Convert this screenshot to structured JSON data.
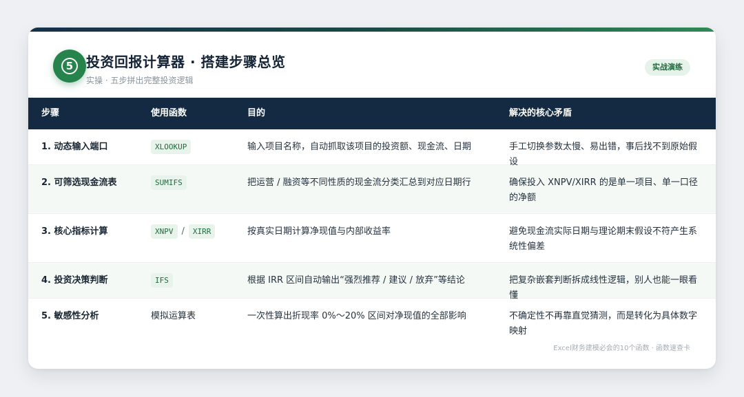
{
  "header": {
    "step_badge": "5",
    "title": "投资回报计算器 · 搭建步骤总览",
    "subtitle": "实操 · 五步拼出完整投资逻辑",
    "pill_label": "实战演练"
  },
  "table": {
    "columns": [
      "步骤",
      "使用函数",
      "目的",
      "解决的核心矛盾"
    ],
    "rows": [
      {
        "step": "1. 动态输入端口",
        "functions": [
          "XLOOKUP"
        ],
        "purpose": "输入项目名称，自动抓取该项目的投资额、现金流、日期",
        "conflict": "手工切换参数太慢、易出错，事后找不到原始假设"
      },
      {
        "step": "2. 可筛选现金流表",
        "functions": [
          "SUMIFS"
        ],
        "purpose": "把运营 / 融资等不同性质的现金流分类汇总到对应日期行",
        "conflict": "确保投入 XNPV/XIRR 的是单一项目、单一口径的净额"
      },
      {
        "step": "3. 核心指标计算",
        "functions": [
          "XNPV",
          "XIRR"
        ],
        "function_separator": "/",
        "purpose": "按真实日期计算净现值与内部收益率",
        "conflict": "避免现金流实际日期与理论期末假设不符产生系统性偏差"
      },
      {
        "step": "4. 投资决策判断",
        "functions": [
          "IFS"
        ],
        "purpose": "根据 IRR 区间自动输出“强烈推荐 / 建议 / 放弃”等结论",
        "conflict": "把复杂嵌套判断拆成线性逻辑，别人也能一眼看懂"
      },
      {
        "step": "5. 敏感性分析",
        "function_text": "模拟运算表",
        "purpose": "一次性算出折现率 0%～20% 区间对净现值的全部影响",
        "conflict": "不确定性不再靠直觉猜测，而是转化为具体数字映射"
      }
    ]
  },
  "footer": {
    "text": "Excel财务建模必会的10个函数 · 函数速查卡"
  },
  "colors": {
    "header_bg": "#142a43",
    "accent_green": "#27834c",
    "alt_row_bg": "#f4f9f5",
    "code_bg": "#e8f3ec",
    "code_text": "#1f6b3d"
  },
  "icons": {
    "step_badge": "circled-number-icon"
  }
}
